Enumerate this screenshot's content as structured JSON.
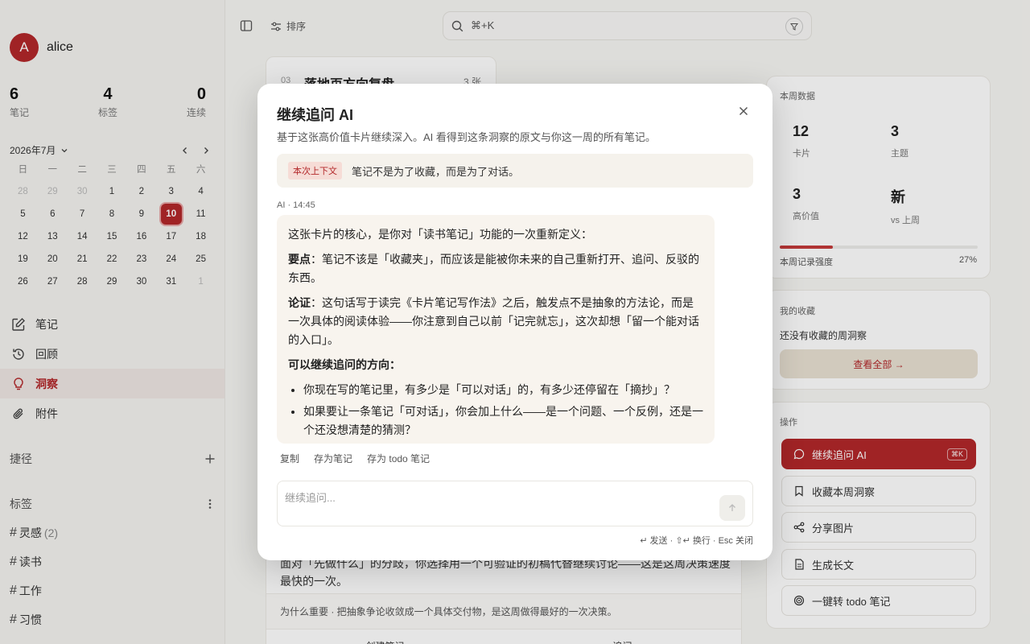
{
  "user": {
    "initial": "A",
    "name": "alice"
  },
  "stats": [
    {
      "value": "6",
      "label": "笔记"
    },
    {
      "value": "4",
      "label": "标签"
    },
    {
      "value": "0",
      "label": "连续"
    }
  ],
  "calendar": {
    "title": "2026年7月",
    "weekdays": [
      "日",
      "一",
      "二",
      "三",
      "四",
      "五",
      "六"
    ],
    "days": [
      "28",
      "29",
      "30",
      "1",
      "2",
      "3",
      "4",
      "5",
      "6",
      "7",
      "8",
      "9",
      "10",
      "11",
      "12",
      "13",
      "14",
      "15",
      "16",
      "17",
      "18",
      "19",
      "20",
      "21",
      "22",
      "23",
      "24",
      "25",
      "26",
      "27",
      "28",
      "29",
      "30",
      "31",
      "1"
    ],
    "today": "10"
  },
  "nav": [
    {
      "label": "笔记",
      "icon": "edit-icon"
    },
    {
      "label": "回顾",
      "icon": "history-icon"
    },
    {
      "label": "洞察",
      "icon": "lightbulb-icon"
    },
    {
      "label": "附件",
      "icon": "paperclip-icon"
    }
  ],
  "shortcuts_label": "捷径",
  "tags_label": "标签",
  "tags": [
    {
      "name": "灵感",
      "count": "(2)"
    },
    {
      "name": "读书",
      "count": ""
    },
    {
      "name": "工作",
      "count": ""
    },
    {
      "name": "习惯",
      "count": ""
    }
  ],
  "topbar": {
    "sort_label": "排序",
    "search_placeholder": "⌘+K"
  },
  "behind_card": {
    "index": "03",
    "title": "落地页方向复盘",
    "count": "3 张"
  },
  "bottom_card": {
    "text": "面对「先做什么」的分歧，你选择用一个可验证的初稿代替继续讨论——这是这周决策速度最快的一次。",
    "why": "为什么重要 · 把抽象争论收敛成一个具体交付物，是这周做得最好的一次决策。",
    "actions": [
      "创建笔记",
      "追问"
    ]
  },
  "weekly": {
    "heading": "本周数据",
    "cells": [
      {
        "value": "12",
        "label": "卡片"
      },
      {
        "value": "3",
        "label": "主题"
      },
      {
        "value": "3",
        "label": "高价值"
      },
      {
        "value": "新",
        "label": "vs 上周"
      }
    ],
    "strength_label": "本周记录强度",
    "strength_pct": "27%",
    "strength_value": 27
  },
  "favorites": {
    "heading": "我的收藏",
    "empty": "还没有收藏的周洞察",
    "view_all": "查看全部 →"
  },
  "operations": {
    "heading": "操作",
    "items": [
      {
        "label": "继续追问 AI",
        "icon": "chat-bubble-icon",
        "kbd": "⌘K"
      },
      {
        "label": "收藏本周洞察",
        "icon": "bookmark-icon"
      },
      {
        "label": "分享图片",
        "icon": "share-icon"
      },
      {
        "label": "生成长文",
        "icon": "document-icon"
      },
      {
        "label": "一键转 todo 笔记",
        "icon": "target-icon"
      }
    ]
  },
  "modal": {
    "title": "继续追问 AI",
    "subtitle": "基于这张高价值卡片继续深入。AI 看得到这条洞察的原文与你这一周的所有笔记。",
    "context_badge": "本次上下文",
    "context_text": "笔记不是为了收藏，而是为了对话。",
    "meta": "AI · 14:45",
    "intro": "这张卡片的核心，是你对「读书笔记」功能的一次重新定义：",
    "point_label": "要点",
    "point_text": "：笔记不该是「收藏夹」，而应该是能被你未来的自己重新打开、追问、反驳的东西。",
    "evidence_label": "论证",
    "evidence_text": "：这句话写于读完《卡片笔记写作法》之后，触发点不是抽象的方法论，而是一次具体的阅读体验——你注意到自己以前「记完就忘」，这次却想「留一个能对话的入口」。",
    "directions_label": "可以继续追问的方向：",
    "bullets": [
      "你现在写的笔记里，有多少是「可以对话」的，有多少还停留在「摘抄」？",
      "如果要让一条笔记「可对话」，你会加上什么——是一个问题、一个反例，还是一个还没想清楚的猜测？"
    ],
    "msg_actions": [
      "复制",
      "存为笔记",
      "存为 todo 笔记"
    ],
    "input_placeholder": "继续追问...",
    "hint": "↵ 发送 · ⇧↵ 换行 · Esc 关闭"
  }
}
